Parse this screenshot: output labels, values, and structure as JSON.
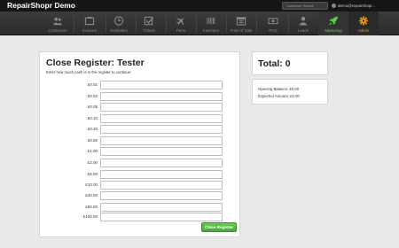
{
  "app": {
    "brand": "RepairShopr Demo",
    "search_placeholder": "Customer Search",
    "user_email": "demo@repairshopr..."
  },
  "nav": {
    "items": [
      {
        "label": "Customers",
        "icon": "users-icon"
      },
      {
        "label": "Invoices",
        "icon": "invoice-icon"
      },
      {
        "label": "Estimates",
        "icon": "clock-icon"
      },
      {
        "label": "Tickets",
        "icon": "checkbox-icon"
      },
      {
        "label": "Parts",
        "icon": "airplane-icon"
      },
      {
        "label": "Inventory",
        "icon": "barcode-icon"
      },
      {
        "label": "Point of Sale",
        "icon": "calendar-icon"
      },
      {
        "label": "POS",
        "icon": "cash-icon"
      },
      {
        "label": "Leads",
        "icon": "user-icon"
      },
      {
        "label": "Marketing",
        "icon": "rocket-icon"
      },
      {
        "label": "Admin",
        "icon": "gear-icon"
      }
    ],
    "marketing_color": "#5ccf46",
    "admin_color": "#f39c12"
  },
  "register": {
    "title": "Close Register: Tester",
    "instructions": "Enter how much cash is in the register to continue:",
    "denominations": [
      "£0.01",
      "£0.02",
      "£0.05",
      "£0.10",
      "£0.20",
      "£0.50",
      "£1.00",
      "£2.00",
      "£5.00",
      "£10.00",
      "£20.00",
      "£50.00",
      "£100.00"
    ],
    "close_button": "Close Register"
  },
  "summary": {
    "total": "Total: 0",
    "opening_balance": "Opening Balance: £0.00",
    "expected_amount": "Expected Amount: £0.00"
  }
}
